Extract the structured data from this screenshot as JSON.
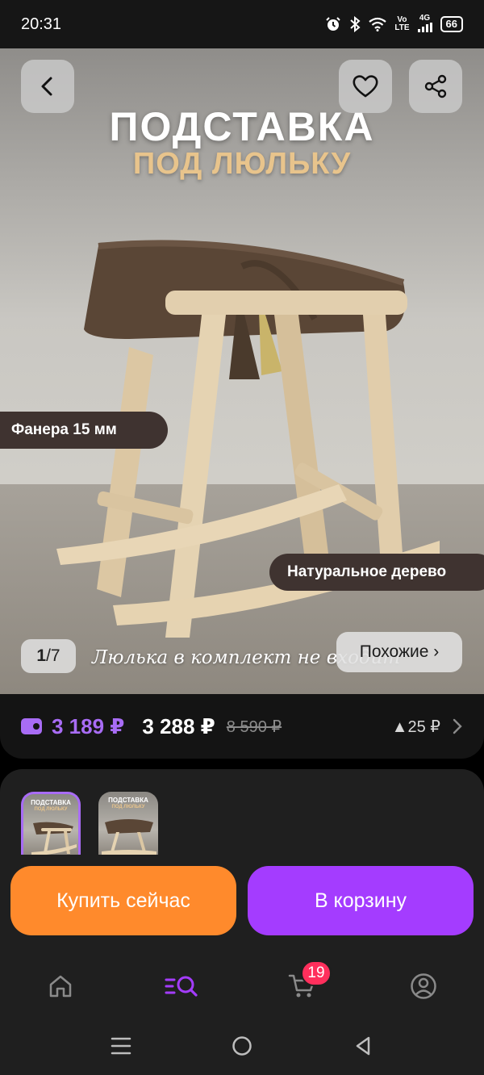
{
  "status_bar": {
    "time": "20:31",
    "signal_vo": "Vo",
    "signal_lte": "LTE",
    "network": "4G",
    "battery": "66"
  },
  "hero": {
    "title": "ПОДСТАВКА",
    "subtitle": "ПОД ЛЮЛЬКУ",
    "tag_plywood": "Фанера 15 мм",
    "tag_wood": "Натуральное дерево",
    "note": "Люлька в комплект не входит",
    "counter_current": "1",
    "counter_separator": "/",
    "counter_total": "7",
    "similar_label": "Похожие ›"
  },
  "price": {
    "wallet_price": "3 189 ₽",
    "price": "3 288 ₽",
    "old_price": "8 590 ₽",
    "rise": "▲25 ₽"
  },
  "thumbnails": [
    {
      "title": "ПОДСТАВКА",
      "subtitle": "ПОД ЛЮЛЬКУ"
    },
    {
      "title": "ПОДСТАВКА",
      "subtitle": "ПОД ЛЮЛЬКУ"
    }
  ],
  "actions": {
    "buy_now": "Купить сейчас",
    "add_to_cart": "В корзину"
  },
  "bottom_nav": {
    "cart_badge": "19"
  },
  "colors": {
    "accent_purple": "#a43cff",
    "wallet_purple": "#a86cf5",
    "buy_orange": "#ff8a2c",
    "badge_red": "#ff2f5c"
  }
}
